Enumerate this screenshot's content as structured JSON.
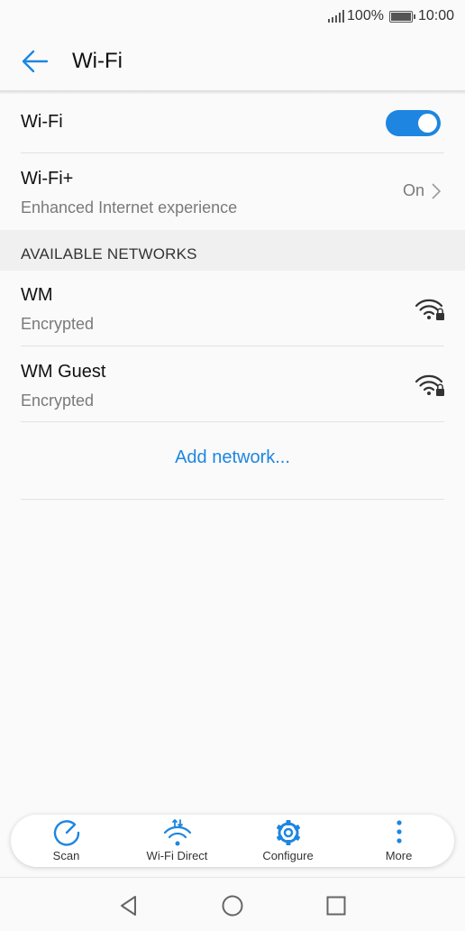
{
  "status_bar": {
    "battery_percent": "100%",
    "time": "10:00"
  },
  "header": {
    "title": "Wi-Fi",
    "back_icon": "arrow-left-icon"
  },
  "wifi": {
    "label": "Wi-Fi",
    "enabled": true
  },
  "wifi_plus": {
    "label": "Wi-Fi+",
    "subtitle": "Enhanced Internet experience",
    "value": "On"
  },
  "section": {
    "available_networks": "AVAILABLE NETWORKS"
  },
  "networks": [
    {
      "name": "WM",
      "status": "Encrypted",
      "icon": "wifi-lock-icon"
    },
    {
      "name": "WM Guest",
      "status": "Encrypted",
      "icon": "wifi-lock-icon"
    }
  ],
  "add_network": {
    "label": "Add network..."
  },
  "toolbar": {
    "items": [
      {
        "label": "Scan",
        "icon": "scan-icon"
      },
      {
        "label": "Wi-Fi Direct",
        "icon": "wifi-direct-icon"
      },
      {
        "label": "Configure",
        "icon": "gear-icon"
      },
      {
        "label": "More",
        "icon": "more-vertical-icon"
      }
    ]
  },
  "colors": {
    "accent": "#1e86e0",
    "background": "#fafafa",
    "section_band": "#f0f0f0"
  }
}
